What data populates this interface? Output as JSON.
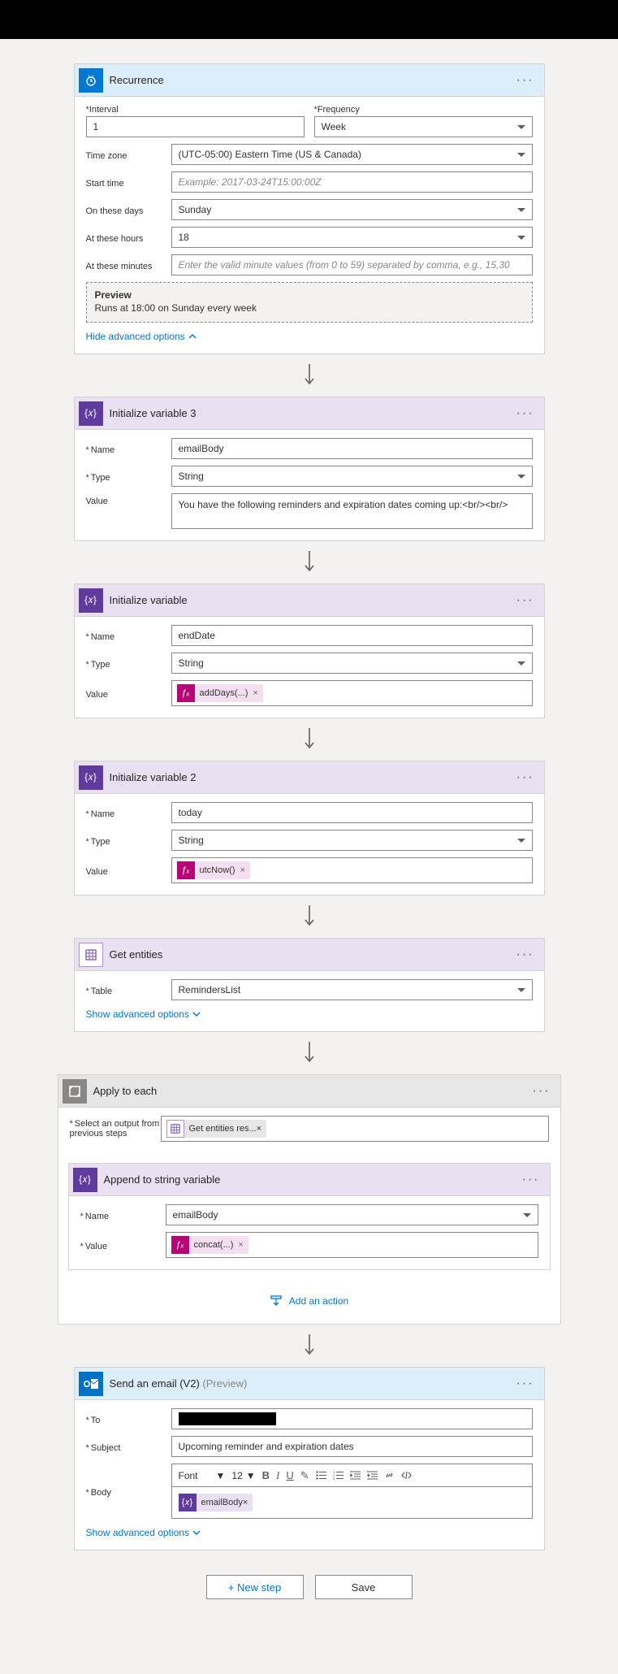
{
  "recurrence": {
    "title": "Recurrence",
    "interval_label": "Interval",
    "interval_value": "1",
    "frequency_label": "Frequency",
    "frequency_value": "Week",
    "timezone_label": "Time zone",
    "timezone_value": "(UTC-05:00) Eastern Time (US & Canada)",
    "starttime_label": "Start time",
    "starttime_placeholder": "Example: 2017-03-24T15:00:00Z",
    "days_label": "On these days",
    "days_value": "Sunday",
    "hours_label": "At these hours",
    "hours_value": "18",
    "minutes_label": "At these minutes",
    "minutes_placeholder": "Enter the valid minute values (from 0 to 59) separated by comma, e.g., 15,30",
    "preview_title": "Preview",
    "preview_text": "Runs at 18:00 on Sunday every week",
    "hide_link": "Hide advanced options"
  },
  "init3": {
    "title": "Initialize variable 3",
    "name_label": "Name",
    "name_value": "emailBody",
    "type_label": "Type",
    "type_value": "String",
    "value_label": "Value",
    "value_text": "You have the following reminders and expiration dates coming up:<br/><br/>"
  },
  "init1": {
    "title": "Initialize variable",
    "name_label": "Name",
    "name_value": "endDate",
    "type_label": "Type",
    "type_value": "String",
    "value_label": "Value",
    "fx_text": "addDays(...)"
  },
  "init2": {
    "title": "Initialize variable 2",
    "name_label": "Name",
    "name_value": "today",
    "type_label": "Type",
    "type_value": "String",
    "value_label": "Value",
    "fx_text": "utcNow()"
  },
  "getentities": {
    "title": "Get entities",
    "table_label": "Table",
    "table_value": "RemindersList",
    "show_link": "Show advanced options"
  },
  "applyeach": {
    "title": "Apply to each",
    "select_label": "Select an output from previous steps",
    "entity_chip": "Get entities res...",
    "add_action_label": "Add an action"
  },
  "append": {
    "title": "Append to string variable",
    "name_label": "Name",
    "name_value": "emailBody",
    "value_label": "Value",
    "fx_text": "concat(...)"
  },
  "sendemail": {
    "title": "Send an email (V2)",
    "preview_tag": "(Preview)",
    "to_label": "To",
    "subject_label": "Subject",
    "subject_value": "Upcoming reminder and expiration dates",
    "body_label": "Body",
    "font_label": "Font",
    "size_label": "12",
    "var_chip": "emailBody",
    "show_link": "Show advanced options"
  },
  "buttons": {
    "new_step": "+ New step",
    "save": "Save"
  }
}
